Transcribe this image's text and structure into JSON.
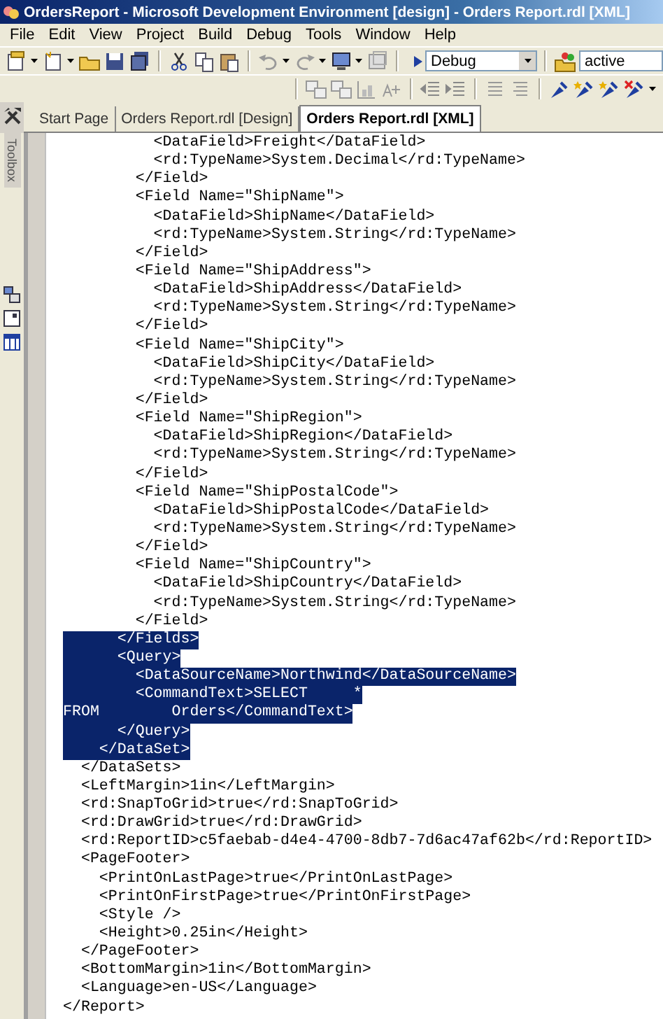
{
  "window": {
    "title": "OrdersReport - Microsoft Development Environment [design] - Orders Report.rdl [XML]"
  },
  "menu": [
    "File",
    "Edit",
    "View",
    "Project",
    "Build",
    "Debug",
    "Tools",
    "Window",
    "Help"
  ],
  "toolbar": {
    "configuration": {
      "value": "Debug"
    },
    "find": {
      "value": "active"
    }
  },
  "toolbox": {
    "label": "Toolbox"
  },
  "tabs": [
    {
      "label": "Start Page",
      "selected": false
    },
    {
      "label": "Orders Report.rdl [Design]",
      "selected": false
    },
    {
      "label": "Orders Report.rdl [XML]",
      "selected": true
    }
  ],
  "editor": {
    "lines": [
      {
        "text": "          <DataField>Freight</DataField>",
        "selected": false
      },
      {
        "text": "          <rd:TypeName>System.Decimal</rd:TypeName>",
        "selected": false
      },
      {
        "text": "        </Field>",
        "selected": false
      },
      {
        "text": "        <Field Name=\"ShipName\">",
        "selected": false
      },
      {
        "text": "          <DataField>ShipName</DataField>",
        "selected": false
      },
      {
        "text": "          <rd:TypeName>System.String</rd:TypeName>",
        "selected": false
      },
      {
        "text": "        </Field>",
        "selected": false
      },
      {
        "text": "        <Field Name=\"ShipAddress\">",
        "selected": false
      },
      {
        "text": "          <DataField>ShipAddress</DataField>",
        "selected": false
      },
      {
        "text": "          <rd:TypeName>System.String</rd:TypeName>",
        "selected": false
      },
      {
        "text": "        </Field>",
        "selected": false
      },
      {
        "text": "        <Field Name=\"ShipCity\">",
        "selected": false
      },
      {
        "text": "          <DataField>ShipCity</DataField>",
        "selected": false
      },
      {
        "text": "          <rd:TypeName>System.String</rd:TypeName>",
        "selected": false
      },
      {
        "text": "        </Field>",
        "selected": false
      },
      {
        "text": "        <Field Name=\"ShipRegion\">",
        "selected": false
      },
      {
        "text": "          <DataField>ShipRegion</DataField>",
        "selected": false
      },
      {
        "text": "          <rd:TypeName>System.String</rd:TypeName>",
        "selected": false
      },
      {
        "text": "        </Field>",
        "selected": false
      },
      {
        "text": "        <Field Name=\"ShipPostalCode\">",
        "selected": false
      },
      {
        "text": "          <DataField>ShipPostalCode</DataField>",
        "selected": false
      },
      {
        "text": "          <rd:TypeName>System.String</rd:TypeName>",
        "selected": false
      },
      {
        "text": "        </Field>",
        "selected": false
      },
      {
        "text": "        <Field Name=\"ShipCountry\">",
        "selected": false
      },
      {
        "text": "          <DataField>ShipCountry</DataField>",
        "selected": false
      },
      {
        "text": "          <rd:TypeName>System.String</rd:TypeName>",
        "selected": false
      },
      {
        "text": "        </Field>",
        "selected": false
      },
      {
        "text": "      </Fields>",
        "selected": true
      },
      {
        "text": "      <Query>",
        "selected": true
      },
      {
        "text": "        <DataSourceName>Northwind</DataSourceName>",
        "selected": true
      },
      {
        "text": "        <CommandText>SELECT     *",
        "selected": true
      },
      {
        "text": "FROM        Orders</CommandText>",
        "selected": true
      },
      {
        "text": "      </Query>",
        "selected": true
      },
      {
        "text": "    </DataSet>",
        "selected": true
      },
      {
        "text": "  </DataSets>",
        "selected": false
      },
      {
        "text": "  <LeftMargin>1in</LeftMargin>",
        "selected": false
      },
      {
        "text": "  <rd:SnapToGrid>true</rd:SnapToGrid>",
        "selected": false
      },
      {
        "text": "  <rd:DrawGrid>true</rd:DrawGrid>",
        "selected": false
      },
      {
        "text": "  <rd:ReportID>c5faebab-d4e4-4700-8db7-7d6ac47af62b</rd:ReportID>",
        "selected": false
      },
      {
        "text": "  <PageFooter>",
        "selected": false
      },
      {
        "text": "    <PrintOnLastPage>true</PrintOnLastPage>",
        "selected": false
      },
      {
        "text": "    <PrintOnFirstPage>true</PrintOnFirstPage>",
        "selected": false
      },
      {
        "text": "    <Style />",
        "selected": false
      },
      {
        "text": "    <Height>0.25in</Height>",
        "selected": false
      },
      {
        "text": "  </PageFooter>",
        "selected": false
      },
      {
        "text": "  <BottomMargin>1in</BottomMargin>",
        "selected": false
      },
      {
        "text": "  <Language>en-US</Language>",
        "selected": false
      },
      {
        "text": "</Report>",
        "selected": false
      }
    ]
  }
}
